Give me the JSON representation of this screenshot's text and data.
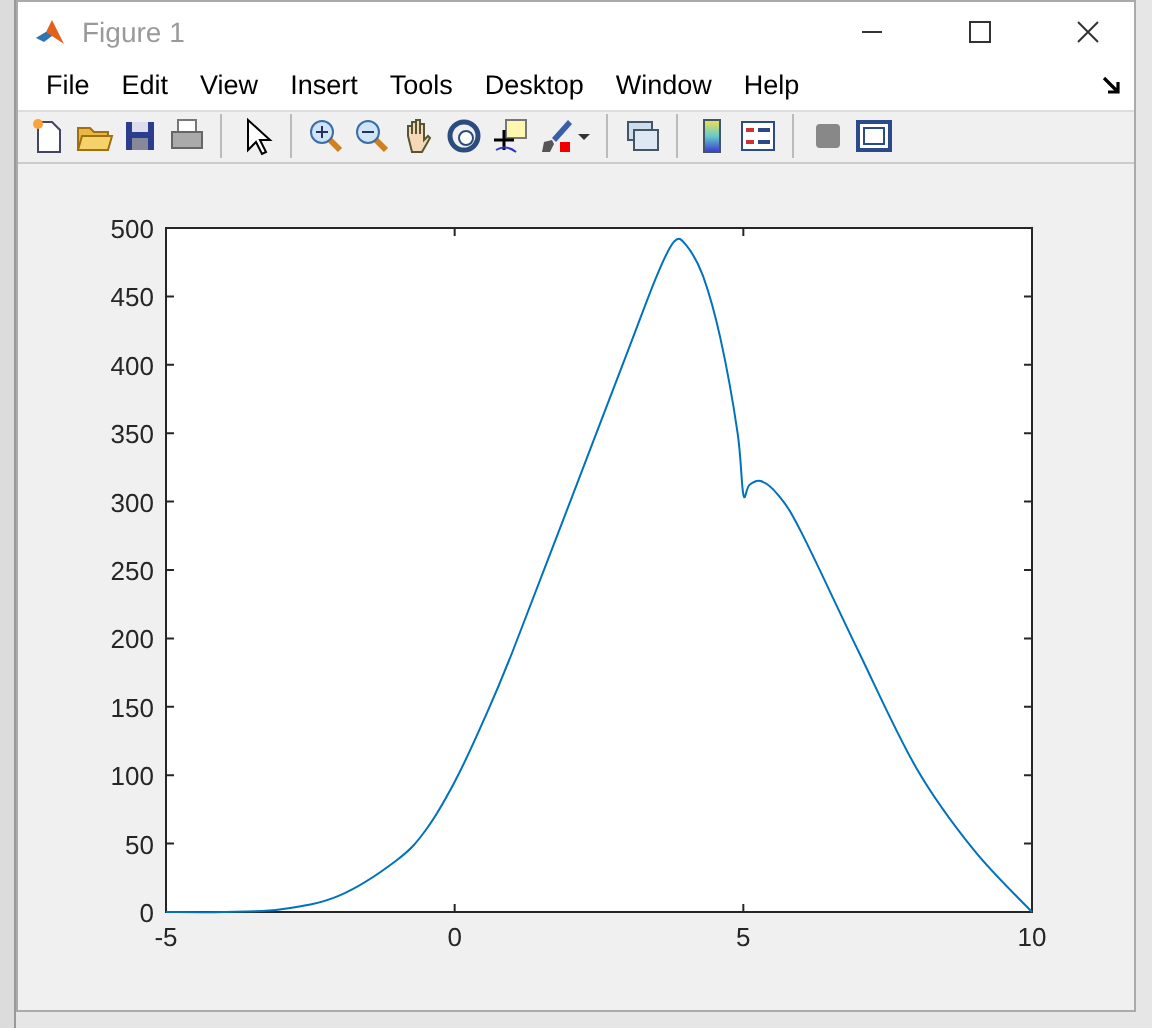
{
  "window": {
    "title": "Figure 1"
  },
  "menu": [
    "File",
    "Edit",
    "View",
    "Insert",
    "Tools",
    "Desktop",
    "Window",
    "Help"
  ],
  "axes": {
    "chart_data": {
      "type": "line",
      "x": [
        -5,
        -4,
        -3,
        -2,
        -1,
        -0.5,
        0,
        0.5,
        1,
        2,
        3,
        3.5,
        3.8,
        4,
        4.3,
        4.6,
        4.9,
        5,
        5.1,
        5.3,
        5.6,
        6,
        7,
        8,
        9,
        10
      ],
      "series": [
        {
          "color": "#0072bd",
          "values": [
            0,
            0,
            2,
            12,
            38,
            60,
            95,
            140,
            190,
            300,
            410,
            465,
            490,
            488,
            465,
            420,
            350,
            305,
            312,
            315,
            305,
            278,
            190,
            105,
            45,
            0
          ]
        }
      ],
      "xlim": [
        -5,
        10
      ],
      "ylim": [
        0,
        500
      ],
      "xticks": [
        -5,
        0,
        5,
        10
      ],
      "yticks": [
        0,
        50,
        100,
        150,
        200,
        250,
        300,
        350,
        400,
        450,
        500
      ]
    }
  }
}
